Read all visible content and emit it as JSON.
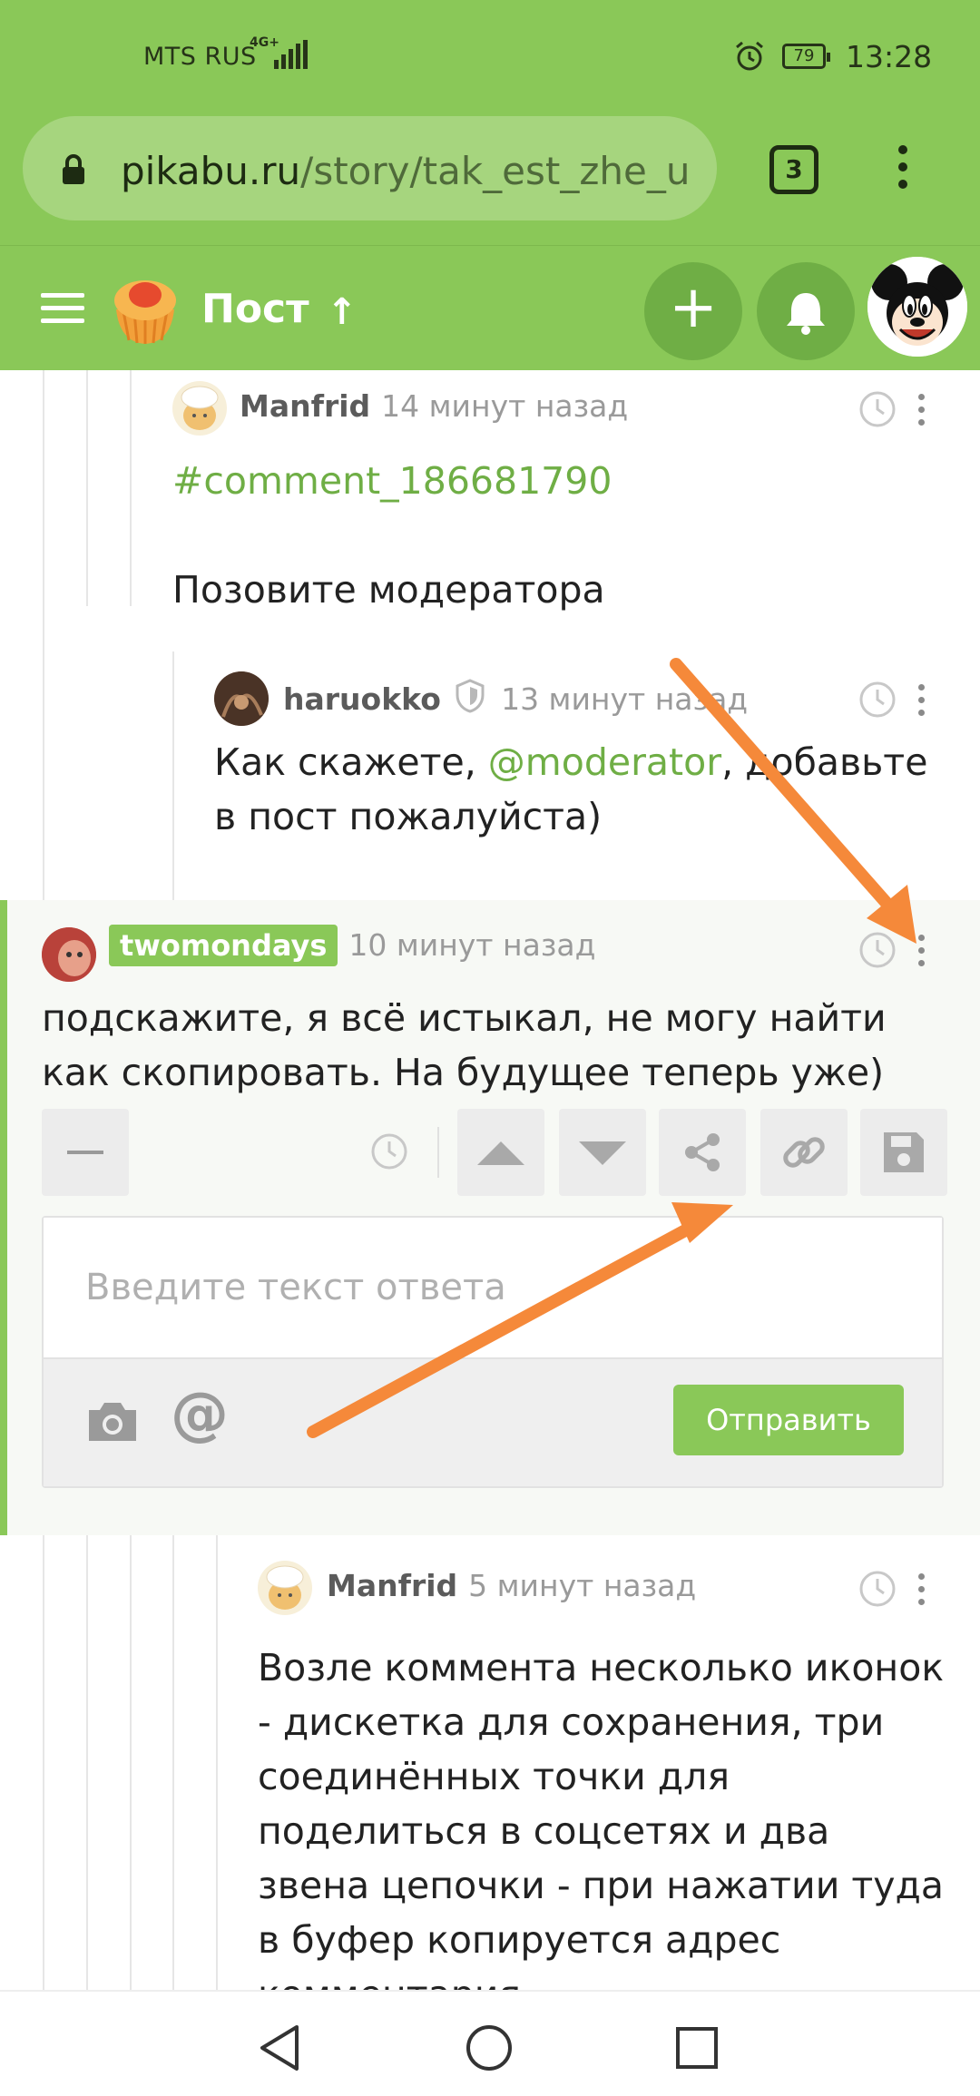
{
  "status_bar": {
    "carrier": "MTS RUS",
    "network": "4G+",
    "battery": "79",
    "time": "13:28"
  },
  "browser": {
    "url_domain": "pikabu.ru",
    "url_path": "/story/tak_est_zhe_u",
    "tabs_count": "3"
  },
  "header": {
    "title": "Пост",
    "up_arrow": "↑",
    "plus": "+"
  },
  "comments": [
    {
      "author": "Manfrid",
      "time": "14 минут назад",
      "link": "#comment_186681790",
      "text": "Позовите модератора"
    },
    {
      "author": "haruokko",
      "time": "13 минут назад",
      "text_before": "Как скажете, ",
      "mention": "@moderator",
      "text_after": ", добавьте в пост пожалуйста)"
    },
    {
      "author": "twomondays",
      "time": "10 минут назад",
      "text": "подскажите, я всё истыкал, не могу найти как скопировать. На будущее теперь уже)"
    },
    {
      "author": "Manfrid",
      "time": "5 минут назад",
      "text": "Возле коммента несколько иконок - дискетка для сохранения, три соединённых точки для поделиться в соцсетях и два звена цепочки - при нажатии туда в буфер копируется адрес комментария"
    }
  ],
  "reply": {
    "placeholder": "Введите текст ответа",
    "send_label": "Отправить",
    "at_symbol": "@"
  },
  "colors": {
    "brand_green": "#8ac858",
    "annotation_arrow": "#f5893a"
  }
}
